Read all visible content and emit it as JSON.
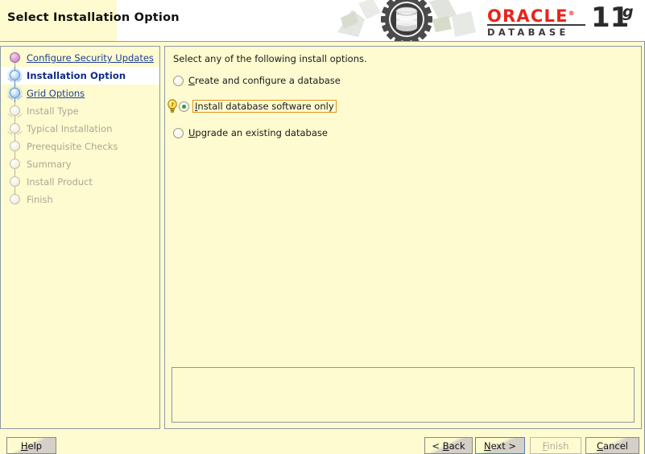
{
  "window": {
    "title": "Select Installation Option"
  },
  "branding": {
    "oracle_word": "ORACLE",
    "trademark": "®",
    "database_word": "DATABASE",
    "version_number": "11",
    "version_suffix": "g",
    "logo_red": "#e8241c",
    "logo_dark": "#3a3a3a"
  },
  "sidebar": {
    "items": [
      {
        "label": "Configure Security Updates",
        "state": "done",
        "style": "link"
      },
      {
        "label": "Installation Option",
        "state": "active",
        "style": "bold"
      },
      {
        "label": "Grid Options",
        "state": "active",
        "style": "link"
      },
      {
        "label": "Install Type",
        "state": "pending",
        "style": "muted"
      },
      {
        "label": "Typical Installation",
        "state": "pending",
        "style": "muted"
      },
      {
        "label": "Prerequisite Checks",
        "state": "pending",
        "style": "muted"
      },
      {
        "label": "Summary",
        "state": "pending",
        "style": "muted"
      },
      {
        "label": "Install Product",
        "state": "pending",
        "style": "muted"
      },
      {
        "label": "Finish",
        "state": "pending",
        "style": "muted"
      }
    ]
  },
  "main": {
    "instruction": "Select any of the following install options.",
    "options": [
      {
        "label_pre": "",
        "mnemonic": "C",
        "label_post": "reate and configure a database",
        "selected": false,
        "focused": false,
        "hint": false
      },
      {
        "label_pre": "",
        "mnemonic": "I",
        "label_post": "nstall database software only",
        "selected": true,
        "focused": true,
        "hint": true
      },
      {
        "label_pre": "",
        "mnemonic": "U",
        "label_post": "pgrade an existing database",
        "selected": false,
        "focused": false,
        "hint": false
      }
    ],
    "message_panel_text": ""
  },
  "buttons": {
    "help": {
      "mnemonic": "H",
      "rest": "elp",
      "disabled": false,
      "focused": false
    },
    "back": {
      "pre": "< ",
      "mnemonic": "B",
      "rest": "ack",
      "disabled": false,
      "focused": false
    },
    "next": {
      "mnemonic": "N",
      "rest": "ext >",
      "disabled": false,
      "focused": true
    },
    "finish": {
      "mnemonic": "F",
      "rest": "inish",
      "disabled": true,
      "focused": false
    },
    "cancel": {
      "mnemonic": "C",
      "rest": "ancel",
      "disabled": false,
      "focused": false
    }
  },
  "colors": {
    "panel_bg": "#fdfbcf",
    "panel_border": "#8d9aa6",
    "link": "#1f3f96",
    "active_label": "#102a83",
    "muted_label": "#aba898",
    "focus_outline": "#e0921f",
    "radio_dot": "#2f9e2f"
  }
}
